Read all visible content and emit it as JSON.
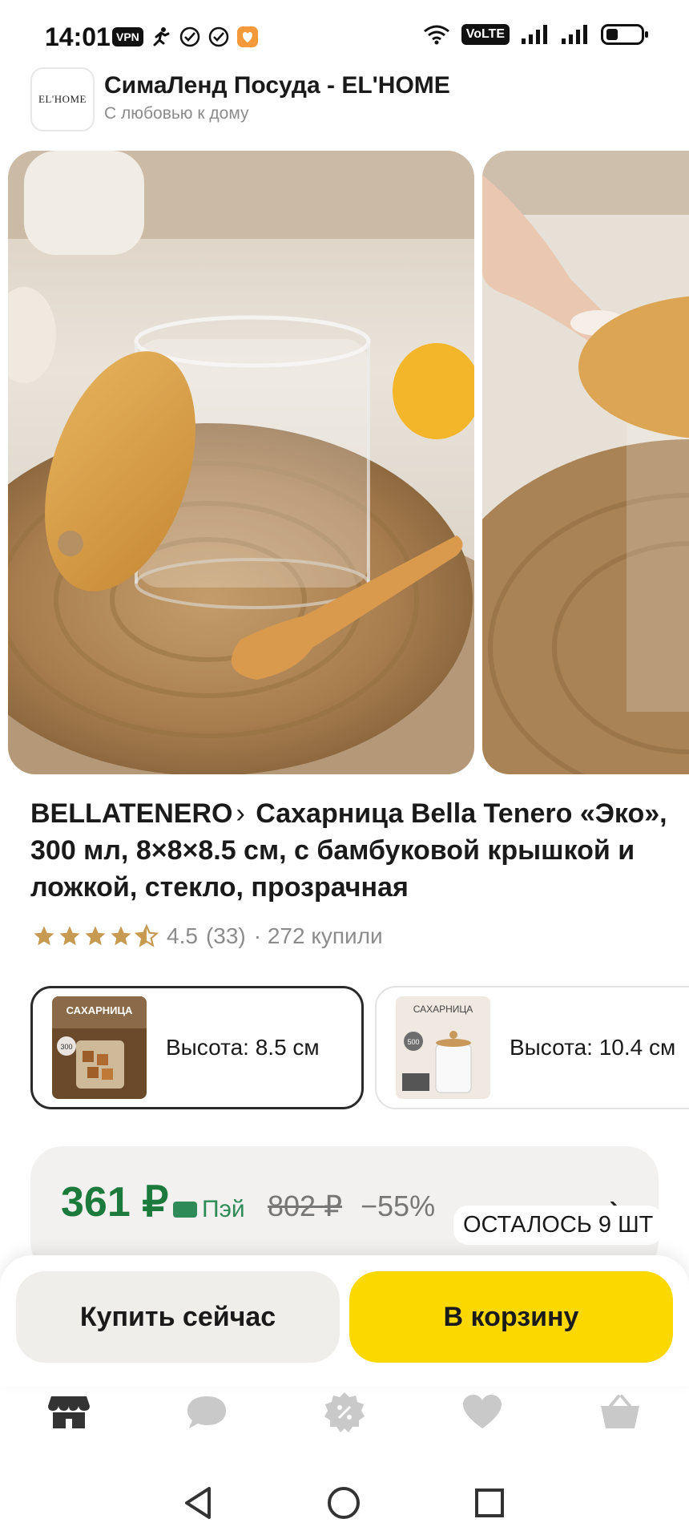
{
  "status_bar": {
    "time": "14:01",
    "vpn": "VPN",
    "volte": "VoLTE",
    "icons": [
      "vpn-icon",
      "running-person-icon",
      "check-circle-icon",
      "check-circle-icon",
      "heart-app-icon",
      "wifi-icon",
      "signal-icon",
      "signal-icon",
      "battery-icon"
    ]
  },
  "shop": {
    "logo_text": "EL'HOME",
    "title": "СимаЛенд Посуда - EL'HOME",
    "subtitle": "С любовью к дому"
  },
  "product": {
    "brand": "BELLATENERO",
    "chevron": "›",
    "title": "Сахарница Bella Tenero «Эко», 300 мл, 8×8×8.5 см, с бамбуковой крышкой и ложкой, стекло, прозрачная",
    "rating": "4.5",
    "reviews": "(33)",
    "bought": "· 272 купили",
    "stars": 4.5
  },
  "variants": [
    {
      "label": "Высота: 8.5 см",
      "selected": true,
      "thumb_text": "САХАРНИЦА",
      "thumb_badge": "300"
    },
    {
      "label": "Высота: 10.4 см",
      "selected": false,
      "thumb_text": "САХАРНИЦА",
      "thumb_badge": "500"
    }
  ],
  "price": {
    "current": "361 ₽",
    "pay_label": "Пэй",
    "old": "802 ₽",
    "discount": "−55%",
    "stock_badge": "ОСТАЛОСЬ 9 ШТ"
  },
  "actions": {
    "buy_now": "Купить сейчас",
    "add_to_cart": "В корзину"
  },
  "bottom_nav": [
    "store-icon",
    "chat-icon",
    "discount-icon",
    "heart-icon",
    "basket-icon"
  ],
  "colors": {
    "price_green": "#1c7a3d",
    "cart_yellow": "#fbd800",
    "star": "#c79a52"
  }
}
